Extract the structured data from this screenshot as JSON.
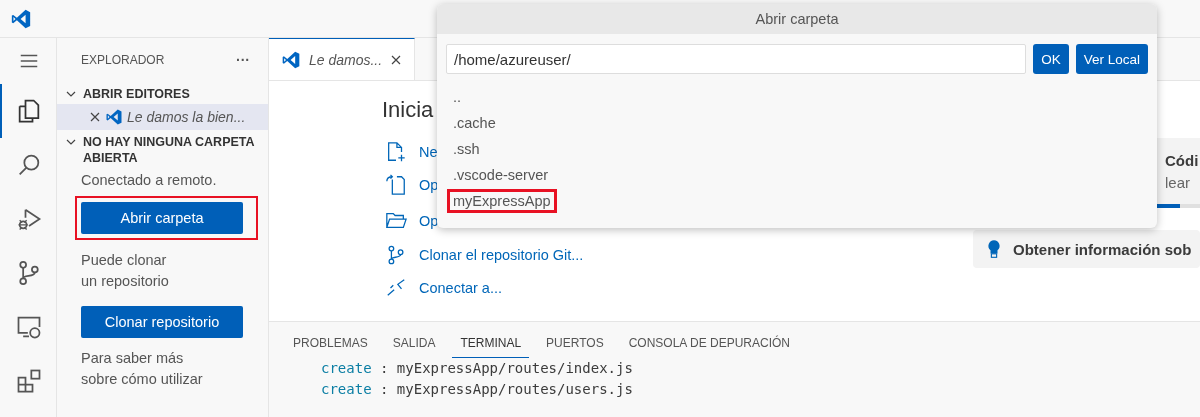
{
  "activity_bar": [
    {
      "kind": "menu",
      "selected": false
    },
    {
      "kind": "files",
      "selected": true
    },
    {
      "kind": "search",
      "selected": false
    },
    {
      "kind": "debug",
      "selected": false
    },
    {
      "kind": "git",
      "selected": false
    },
    {
      "kind": "remote",
      "selected": false
    },
    {
      "kind": "extensions",
      "selected": false
    }
  ],
  "sidebar": {
    "title": "EXPLORADOR",
    "more": "···",
    "sections": [
      {
        "title": "ABRIR EDITORES",
        "expanded": true,
        "items": [
          {
            "label": "Le damos la bien...",
            "selected": true
          }
        ]
      },
      {
        "title": "NO HAY NINGUNA CARPETA ABIERTA",
        "expanded": true
      }
    ],
    "status": "Conectado a remoto.",
    "open_button": {
      "label": "Abrir carpeta",
      "highlighted": true
    },
    "clone_text": [
      "Puede clonar",
      "un repositorio"
    ],
    "clone_button": {
      "label": "Clonar repositorio"
    },
    "more_text": [
      "Para saber más",
      "sobre cómo utilizar"
    ]
  },
  "tabs": [
    {
      "label": "Le damos...",
      "selected": true
    }
  ],
  "welcome": {
    "heading": "Inicia",
    "links": [
      {
        "kind": "new",
        "label": "Ne"
      },
      {
        "kind": "file",
        "label": "Op"
      },
      {
        "kind": "folder",
        "label": "Op"
      },
      {
        "kind": "git",
        "label": "Clonar el repositorio Git..."
      },
      {
        "kind": "remote",
        "label": "Conectar a..."
      }
    ],
    "walkthrough": {
      "title": "Códi",
      "subtitle": "lear",
      "level": 0.55
    },
    "tip": "Obtener información sob"
  },
  "panel": {
    "tabs": [
      {
        "label": "PROBLEMAS",
        "selected": false
      },
      {
        "label": "SALIDA",
        "selected": false
      },
      {
        "label": "TERMINAL",
        "selected": true
      },
      {
        "label": "PUERTOS",
        "selected": false
      },
      {
        "label": "CONSOLA DE DEPURACIÓN",
        "selected": false
      }
    ],
    "lines": [
      {
        "keyword": "create",
        "text": ": myExpressApp/routes/index.js"
      },
      {
        "keyword": "create",
        "text": ": myExpressApp/routes/users.js"
      }
    ]
  },
  "dialog": {
    "title": "Abrir carpeta",
    "value": "/home/azureuser/",
    "ok": "OK",
    "local": "Ver Local",
    "items": [
      {
        "label": "..",
        "highlighted": false
      },
      {
        "label": ".cache",
        "highlighted": false
      },
      {
        "label": ".ssh",
        "highlighted": false
      },
      {
        "label": ".vscode-server",
        "highlighted": false
      },
      {
        "label": "myExpressApp",
        "highlighted": true
      }
    ]
  }
}
